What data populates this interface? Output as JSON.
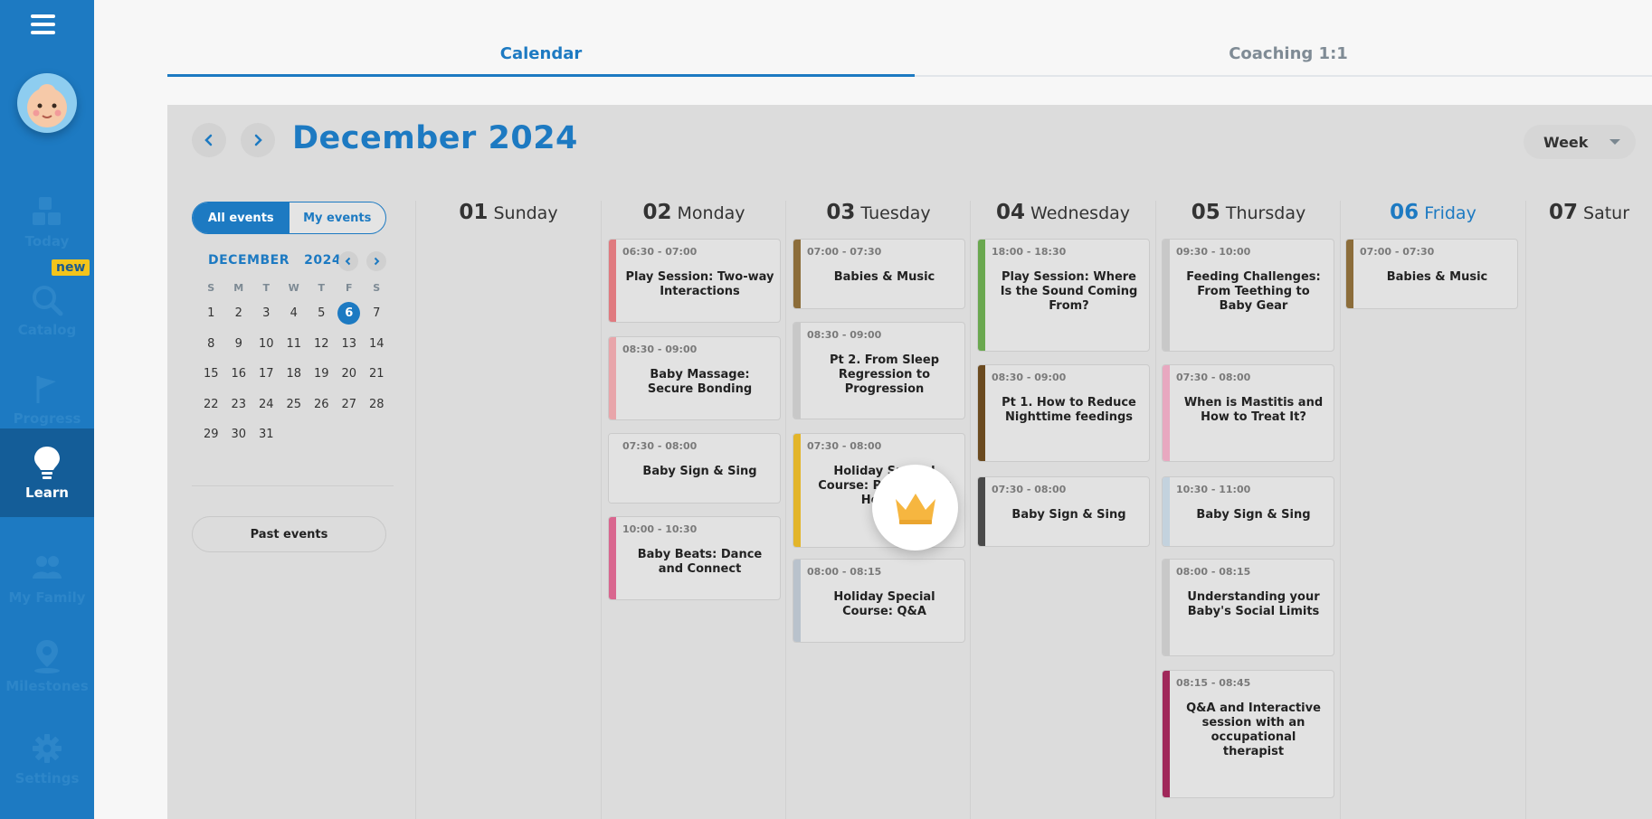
{
  "sidebar": {
    "items": [
      {
        "label": "Today",
        "icon": "blocks-icon"
      },
      {
        "label": "Catalog",
        "icon": "search-icon"
      },
      {
        "label": "Progress",
        "icon": "flag-icon"
      },
      {
        "label": "Learn",
        "icon": "lightbulb-icon"
      },
      {
        "label": "My Family",
        "icon": "family-icon"
      },
      {
        "label": "Milestones",
        "icon": "map-pin-icon"
      },
      {
        "label": "Settings",
        "icon": "gear-icon"
      }
    ],
    "new_badge": "new",
    "active": "Learn"
  },
  "tabs": {
    "calendar": "Calendar",
    "coaching": "Coaching 1:1"
  },
  "calendar": {
    "month_title": "December 2024",
    "view": "Week",
    "filter": {
      "all": "All events",
      "mine": "My events"
    },
    "mini": {
      "month": "DECEMBER",
      "year": "2024",
      "dow": [
        "S",
        "M",
        "T",
        "W",
        "T",
        "F",
        "S"
      ],
      "weeks": [
        [
          "1",
          "2",
          "3",
          "4",
          "5",
          "6",
          "7"
        ],
        [
          "8",
          "9",
          "10",
          "11",
          "12",
          "13",
          "14"
        ],
        [
          "15",
          "16",
          "17",
          "18",
          "19",
          "20",
          "21"
        ],
        [
          "22",
          "23",
          "24",
          "25",
          "26",
          "27",
          "28"
        ],
        [
          "29",
          "30",
          "31",
          "",
          "",
          "",
          ""
        ]
      ],
      "today": "6"
    },
    "past_events": "Past events",
    "days": [
      {
        "num": "01",
        "name": "Sunday"
      },
      {
        "num": "02",
        "name": "Monday"
      },
      {
        "num": "03",
        "name": "Tuesday"
      },
      {
        "num": "04",
        "name": "Wednesday"
      },
      {
        "num": "05",
        "name": "Thursday"
      },
      {
        "num": "06",
        "name": "Friday"
      },
      {
        "num": "07",
        "name": "Satur"
      }
    ],
    "today_index": 5,
    "events": {
      "mon": [
        {
          "time": "06:30 - 07:00",
          "title": "Play Session: Two-way Interactions",
          "color": "#e07a7f"
        },
        {
          "time": "08:30 - 09:00",
          "title": "Baby Massage: Secure Bonding",
          "color": "#e8a5aa"
        },
        {
          "time": "07:30 - 08:00",
          "title": "Baby Sign & Sing",
          "color": "#e2e2e2"
        },
        {
          "time": "10:00 - 10:30",
          "title": "Baby Beats: Dance and Connect",
          "color": "#d9668f"
        }
      ],
      "tue": [
        {
          "time": "07:00 - 07:30",
          "title": "Babies & Music",
          "color": "#8c6d3a"
        },
        {
          "time": "08:30 - 09:00",
          "title": "Pt 2. From Sleep Regression to Progression",
          "color": "#c8c8c8"
        },
        {
          "time": "07:30 - 08:00",
          "title": "Holiday Special Course: Powered by How to",
          "color": "#e3b52a"
        },
        {
          "time": "08:00 - 08:15",
          "title": "Holiday Special Course: Q&A",
          "color": "#b9c2cc"
        }
      ],
      "wed": [
        {
          "time": "18:00 - 18:30",
          "title": "Play Session: Where Is the Sound Coming From?",
          "color": "#6aa84f"
        },
        {
          "time": "08:30 - 09:00",
          "title": "Pt 1. How to Reduce Nighttime feedings",
          "color": "#6b4a1f"
        },
        {
          "time": "07:30 - 08:00",
          "title": "Baby Sign & Sing",
          "color": "#4a4a4a"
        }
      ],
      "thu": [
        {
          "time": "09:30 - 10:00",
          "title": "Feeding Challenges: From Teething to Baby Gear",
          "color": "#c8c8c8"
        },
        {
          "time": "07:30 - 08:00",
          "title": "When is Mastitis and How to Treat It?",
          "color": "#e8a8c0"
        },
        {
          "time": "10:30 - 11:00",
          "title": "Baby Sign & Sing",
          "color": "#c3d2de"
        },
        {
          "time": "08:00 - 08:15",
          "title": "Understanding your Baby's Social Limits",
          "color": "#c8c8c8"
        },
        {
          "time": "08:15 - 08:45",
          "title": "Q&A and Interactive session with an occupational therapist",
          "color": "#a0285a"
        }
      ],
      "fri": [
        {
          "time": "07:00 - 07:30",
          "title": "Babies & Music",
          "color": "#8c6d3a"
        }
      ]
    },
    "premium_icon": "crown-icon"
  }
}
